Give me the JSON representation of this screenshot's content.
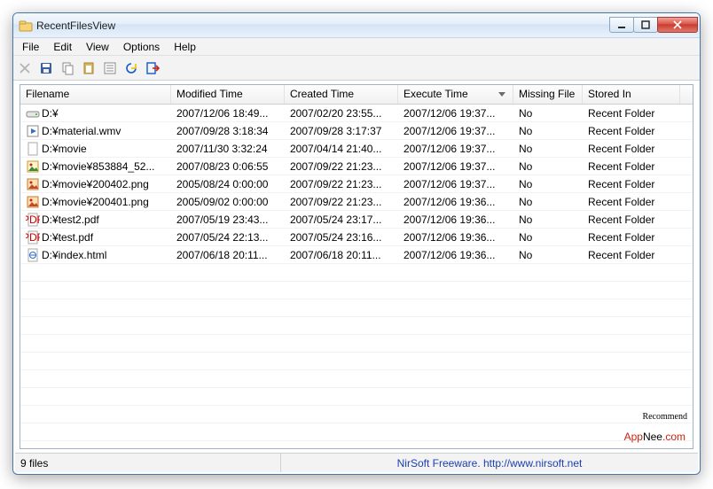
{
  "window": {
    "title": "RecentFilesView"
  },
  "menu": {
    "file": "File",
    "edit": "Edit",
    "view": "View",
    "options": "Options",
    "help": "Help"
  },
  "columns": {
    "filename": "Filename",
    "modified": "Modified Time",
    "created": "Created Time",
    "execute": "Execute Time",
    "missing": "Missing File",
    "stored": "Stored In",
    "sort_column": "execute",
    "sort_dir": "desc"
  },
  "rows": [
    {
      "icon": "drive",
      "name": "D:¥",
      "modified": "2007/12/06 18:49...",
      "created": "2007/02/20 23:55...",
      "execute": "2007/12/06 19:37...",
      "missing": "No",
      "stored": "Recent Folder"
    },
    {
      "icon": "video",
      "name": "D:¥material.wmv",
      "modified": "2007/09/28 3:18:34",
      "created": "2007/09/28 3:17:37",
      "execute": "2007/12/06 19:37...",
      "missing": "No",
      "stored": "Recent Folder"
    },
    {
      "icon": "blank",
      "name": "D:¥movie",
      "modified": "2007/11/30 3:32:24",
      "created": "2007/04/14 21:40...",
      "execute": "2007/12/06 19:37...",
      "missing": "No",
      "stored": "Recent Folder"
    },
    {
      "icon": "image",
      "name": "D:¥movie¥853884_52...",
      "modified": "2007/08/23 0:06:55",
      "created": "2007/09/22 21:23...",
      "execute": "2007/12/06 19:37...",
      "missing": "No",
      "stored": "Recent Folder"
    },
    {
      "icon": "image2",
      "name": "D:¥movie¥200402.png",
      "modified": "2005/08/24 0:00:00",
      "created": "2007/09/22 21:23...",
      "execute": "2007/12/06 19:37...",
      "missing": "No",
      "stored": "Recent Folder"
    },
    {
      "icon": "image2",
      "name": "D:¥movie¥200401.png",
      "modified": "2005/09/02 0:00:00",
      "created": "2007/09/22 21:23...",
      "execute": "2007/12/06 19:36...",
      "missing": "No",
      "stored": "Recent Folder"
    },
    {
      "icon": "pdf",
      "name": "D:¥test2.pdf",
      "modified": "2007/05/19 23:43...",
      "created": "2007/05/24 23:17...",
      "execute": "2007/12/06 19:36...",
      "missing": "No",
      "stored": "Recent Folder"
    },
    {
      "icon": "pdf",
      "name": "D:¥test.pdf",
      "modified": "2007/05/24 22:13...",
      "created": "2007/05/24 23:16...",
      "execute": "2007/12/06 19:36...",
      "missing": "No",
      "stored": "Recent Folder"
    },
    {
      "icon": "html",
      "name": "D:¥index.html",
      "modified": "2007/06/18 20:11...",
      "created": "2007/06/18 20:11...",
      "execute": "2007/12/06 19:36...",
      "missing": "No",
      "stored": "Recent Folder"
    }
  ],
  "status": {
    "count": "9 files",
    "credit": "NirSoft Freeware.  http://www.nirsoft.net"
  },
  "watermark": {
    "a": "App",
    "n": "Nee",
    "dot": ".com",
    "rec": "Recommend"
  }
}
